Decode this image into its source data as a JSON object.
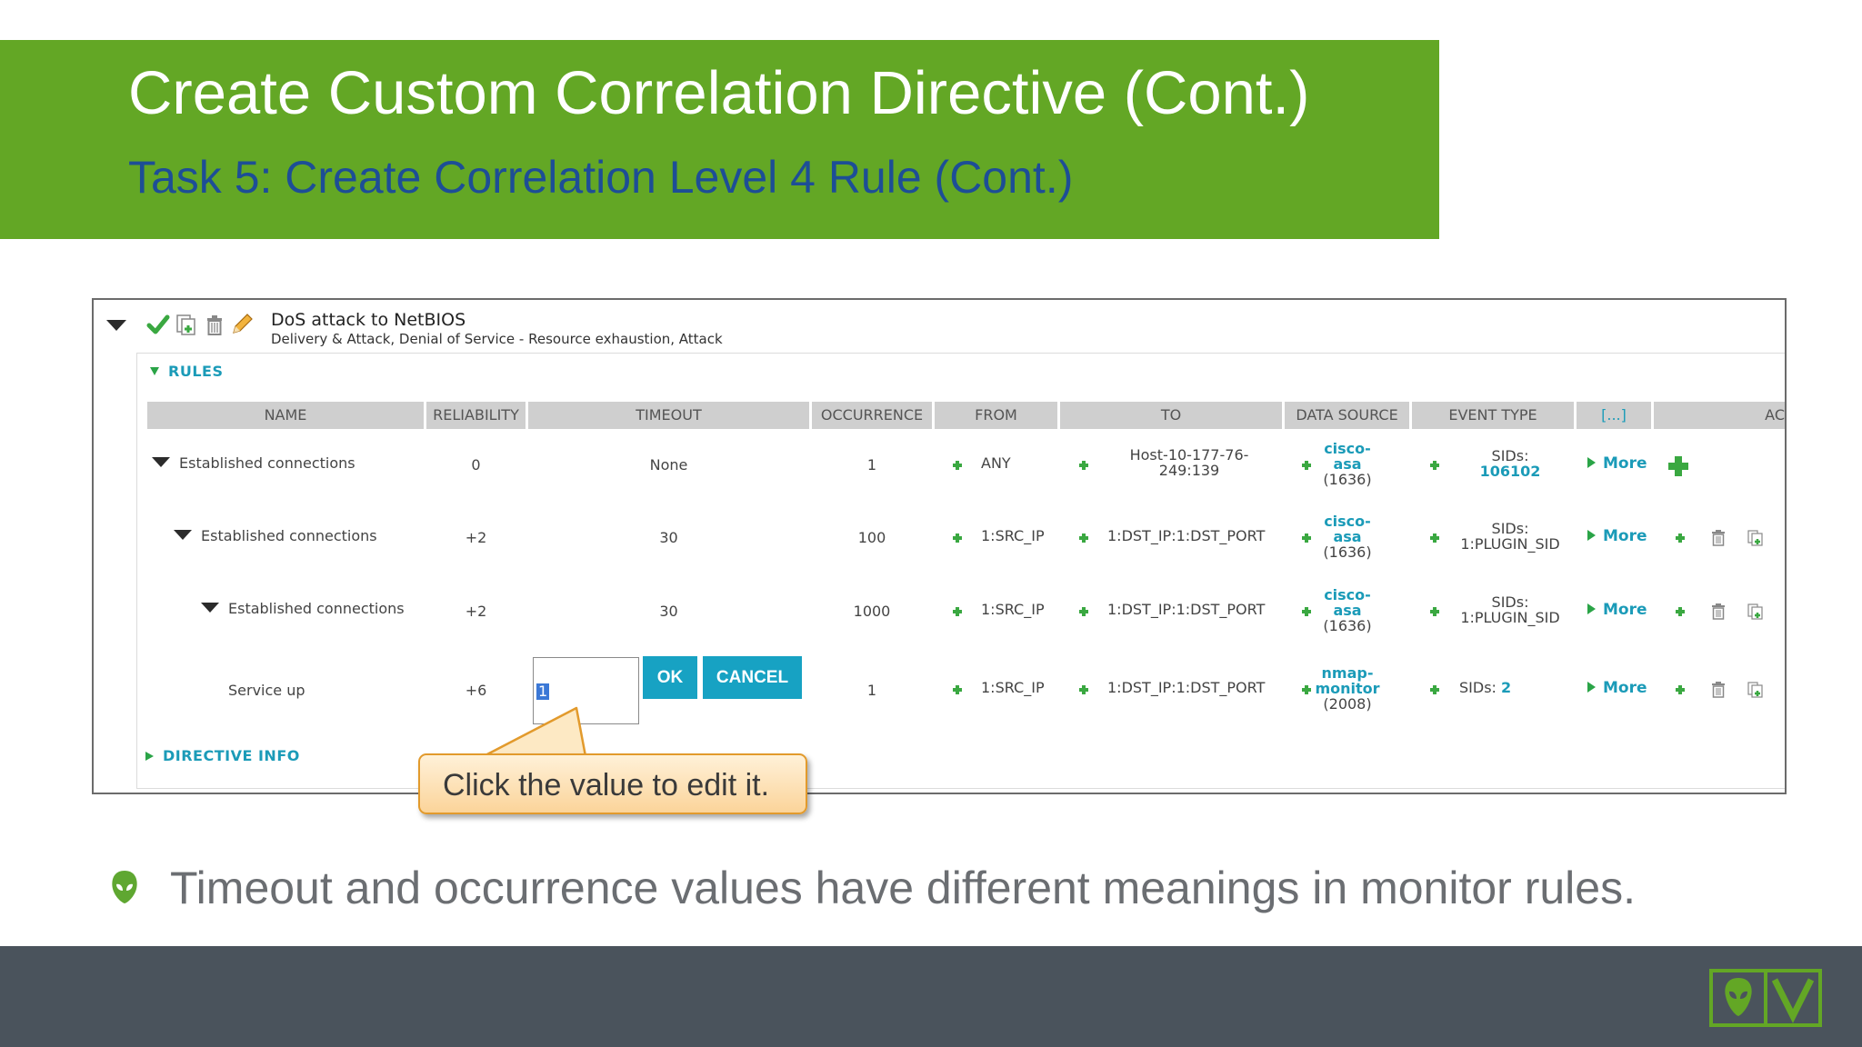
{
  "slide": {
    "title": "Create Custom Correlation Directive (Cont.)",
    "subtitle": "Task 5: Create Correlation Level 4 Rule (Cont.)"
  },
  "directive": {
    "name": "DoS attack to NetBIOS",
    "taxonomy": "Delivery & Attack, Denial of Service - Resource exhaustion, Attack",
    "icons": [
      "check-icon",
      "copy-icon",
      "trash-icon",
      "pencil-icon"
    ]
  },
  "rules": {
    "section_label": "RULES",
    "columns": [
      "NAME",
      "RELIABILITY",
      "TIMEOUT",
      "OCCURRENCE",
      "FROM",
      "TO",
      "DATA SOURCE",
      "EVENT TYPE",
      "[...]",
      "AC"
    ],
    "rows": [
      {
        "name": "Established connections",
        "reliability": "0",
        "timeout": "None",
        "occurrence": "1",
        "from": "ANY",
        "to_line1": "Host-10-177-76-",
        "to_line2": "249:139",
        "ds_line1": "cisco-",
        "ds_line2": "asa",
        "ds_count": "(1636)",
        "sids_label": "SIDs:",
        "sids_value": "106102",
        "more": "More"
      },
      {
        "name": "Established connections",
        "reliability": "+2",
        "timeout": "30",
        "occurrence": "100",
        "from": "1:SRC_IP",
        "to": "1:DST_IP:1:DST_PORT",
        "ds_line1": "cisco-",
        "ds_line2": "asa",
        "ds_count": "(1636)",
        "sids_label": "SIDs:",
        "sids_value": "1:PLUGIN_SID",
        "more": "More"
      },
      {
        "name": "Established connections",
        "reliability": "+2",
        "timeout": "30",
        "occurrence": "1000",
        "from": "1:SRC_IP",
        "to": "1:DST_IP:1:DST_PORT",
        "ds_line1": "cisco-",
        "ds_line2": "asa",
        "ds_count": "(1636)",
        "sids_label": "SIDs:",
        "sids_value": "1:PLUGIN_SID",
        "more": "More"
      },
      {
        "name": "Service up",
        "reliability": "+6",
        "timeout_edit_value": "1",
        "ok_label": "OK",
        "cancel_label": "CANCEL",
        "occurrence": "1",
        "from": "1:SRC_IP",
        "to": "1:DST_IP:1:DST_PORT",
        "ds_line1": "nmap-",
        "ds_line2": "monitor",
        "ds_count": "(2008)",
        "sids_label": "SIDs:",
        "sids_value": "2",
        "more": "More"
      }
    ],
    "directive_info_label": "DIRECTIVE INFO"
  },
  "callout": {
    "text": "Click the value to edit it."
  },
  "bullet": {
    "text": "Timeout and occurrence values have different meanings in monitor rules.",
    "icon": "alien-head-icon"
  },
  "footer": {
    "logo": "alienvault-logo"
  },
  "colors": {
    "banner": "#63a725",
    "subtitle": "#1d4e96",
    "accent": "#17a2c3",
    "link": "#1b9bb8",
    "footer": "#4a535c"
  }
}
